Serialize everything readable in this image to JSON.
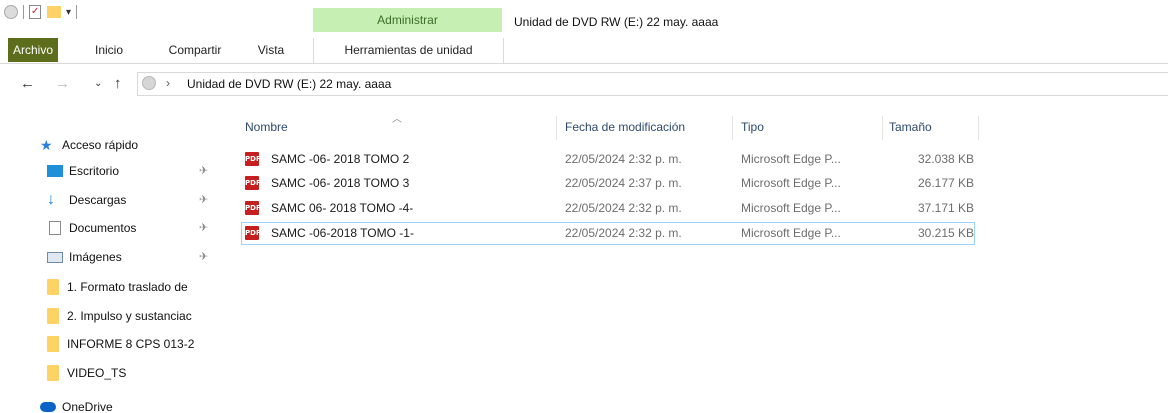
{
  "window": {
    "title": "Unidad de DVD RW (E:) 22 may. aaaa",
    "context_group": "Administrar"
  },
  "ribbon": {
    "tabs": [
      {
        "label": "Archivo"
      },
      {
        "label": "Inicio"
      },
      {
        "label": "Compartir"
      },
      {
        "label": "Vista"
      },
      {
        "label": "Herramientas de unidad"
      }
    ]
  },
  "address": {
    "path": "Unidad de DVD RW (E:) 22 may. aaaa"
  },
  "nav": {
    "quick_access": "Acceso rápido",
    "items": [
      {
        "label": "Escritorio",
        "icon": "desktop-icon",
        "pinned": true
      },
      {
        "label": "Descargas",
        "icon": "download-icon",
        "pinned": true
      },
      {
        "label": "Documentos",
        "icon": "documents-icon",
        "pinned": true
      },
      {
        "label": "Imágenes",
        "icon": "pictures-icon",
        "pinned": true
      },
      {
        "label": "1. Formato traslado de",
        "icon": "folder-icon",
        "pinned": false
      },
      {
        "label": "2. Impulso y sustanciac",
        "icon": "folder-icon",
        "pinned": false
      },
      {
        "label": "INFORME 8  CPS 013-2",
        "icon": "folder-icon",
        "pinned": false
      },
      {
        "label": "VIDEO_TS",
        "icon": "folder-icon",
        "pinned": false
      }
    ],
    "onedrive": "OneDrive"
  },
  "columns": {
    "name": "Nombre",
    "modified": "Fecha de modificación",
    "type": "Tipo",
    "size": "Tamaño"
  },
  "files": [
    {
      "name": "SAMC -06- 2018 TOMO 2",
      "modified": "22/05/2024 2:32 p. m.",
      "type": "Microsoft Edge P...",
      "size": "32.038 KB"
    },
    {
      "name": "SAMC -06- 2018 TOMO 3",
      "modified": "22/05/2024 2:37 p. m.",
      "type": "Microsoft Edge P...",
      "size": "26.177 KB"
    },
    {
      "name": "SAMC 06- 2018 TOMO -4-",
      "modified": "22/05/2024 2:32 p. m.",
      "type": "Microsoft Edge P...",
      "size": "37.171 KB"
    },
    {
      "name": "SAMC -06-2018 TOMO -1-",
      "modified": "22/05/2024 2:32 p. m.",
      "type": "Microsoft Edge P...",
      "size": "30.215 KB"
    }
  ],
  "pdf_badge": "PDF",
  "colors": {
    "file_tab": "#5c6d1b",
    "context_band": "#c6efb3",
    "selection_border": "#99d1ff"
  }
}
